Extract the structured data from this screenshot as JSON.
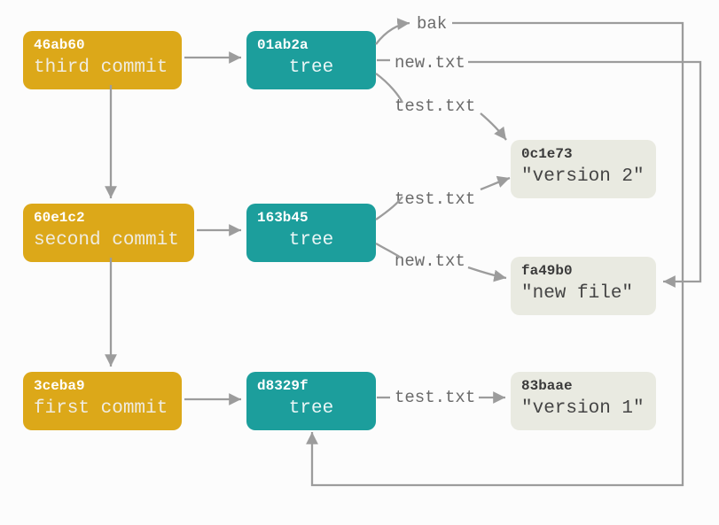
{
  "commits": {
    "c1": {
      "hash": "46ab60",
      "msg": "third commit"
    },
    "c2": {
      "hash": "60e1c2",
      "msg": "second commit"
    },
    "c3": {
      "hash": "3ceba9",
      "msg": "first commit"
    }
  },
  "trees": {
    "t1": {
      "hash": "01ab2a",
      "label": "tree"
    },
    "t2": {
      "hash": "163b45",
      "label": "tree"
    },
    "t3": {
      "hash": "d8329f",
      "label": "tree"
    }
  },
  "blobs": {
    "b1": {
      "hash": "0c1e73",
      "content": "\"version 2\""
    },
    "b2": {
      "hash": "fa49b0",
      "content": "\"new file\""
    },
    "b3": {
      "hash": "83baae",
      "content": "\"version 1\""
    }
  },
  "labels": {
    "bak": "bak",
    "new_txt_1": "new.txt",
    "test_txt_1": "test.txt",
    "test_txt_2": "test.txt",
    "new_txt_2": "new.txt",
    "test_txt_3": "test.txt"
  }
}
